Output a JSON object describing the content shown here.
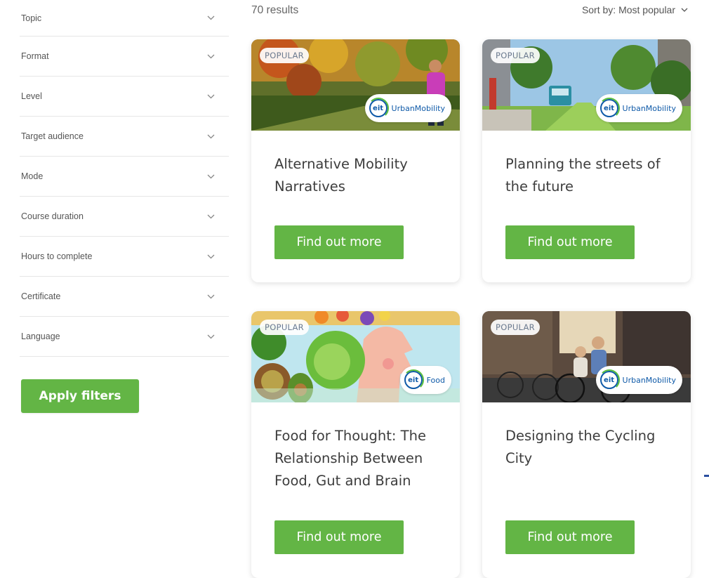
{
  "filters": {
    "items": [
      {
        "label": "Topic"
      },
      {
        "label": "Format"
      },
      {
        "label": "Level"
      },
      {
        "label": "Target audience"
      },
      {
        "label": "Mode"
      },
      {
        "label": "Course duration"
      },
      {
        "label": "Hours to complete"
      },
      {
        "label": "Certificate"
      },
      {
        "label": "Language"
      }
    ],
    "apply_label": "Apply filters"
  },
  "results": {
    "count_text": "70 results",
    "sort_label": "Sort by: Most popular"
  },
  "cards": [
    {
      "badge": "POPULAR",
      "logo_mark": "eit",
      "logo_text": "UrbanMobility",
      "title": "Alternative Mobility Narratives",
      "button": "Find out more"
    },
    {
      "badge": "POPULAR",
      "logo_mark": "eit",
      "logo_text": "UrbanMobility",
      "title": "Planning the streets of the future",
      "button": "Find out more"
    },
    {
      "badge": "POPULAR",
      "logo_mark": "eit",
      "logo_text": "Food",
      "title": "Food for Thought: The Relationship Between Food, Gut and Brain",
      "button": "Find out more"
    },
    {
      "badge": "POPULAR",
      "logo_mark": "eit",
      "logo_text": "UrbanMobility",
      "title": "Designing the Cycling City",
      "button": "Find out more"
    }
  ],
  "colors": {
    "accent_green": "#63b545",
    "eit_blue": "#0f5aa8"
  }
}
